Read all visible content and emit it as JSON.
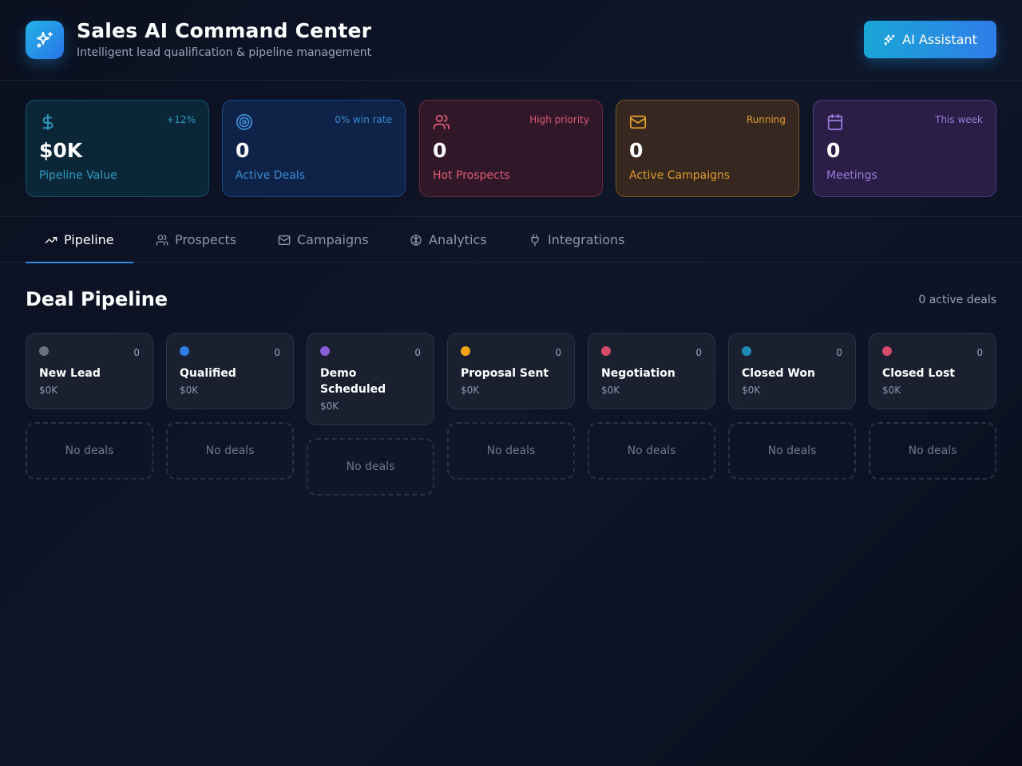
{
  "header": {
    "title": "Sales AI Command Center",
    "subtitle": "Intelligent lead qualification & pipeline management",
    "ai_button_label": "AI Assistant",
    "logo_icon": "sparkles-icon"
  },
  "stats": [
    {
      "icon": "dollar-icon",
      "tag": "+12%",
      "value": "$0K",
      "label": "Pipeline Value",
      "color": "#2d9cc4"
    },
    {
      "icon": "target-icon",
      "tag": "0% win rate",
      "value": "0",
      "label": "Active Deals",
      "color": "#3b8ad6"
    },
    {
      "icon": "users-icon",
      "tag": "High priority",
      "value": "0",
      "label": "Hot Prospects",
      "color": "#e05a78"
    },
    {
      "icon": "mail-icon",
      "tag": "Running",
      "value": "0",
      "label": "Active Campaigns",
      "color": "#e09a2a"
    },
    {
      "icon": "calendar-icon",
      "tag": "This week",
      "value": "0",
      "label": "Meetings",
      "color": "#9a7ad8"
    }
  ],
  "tabs": [
    {
      "label": "Pipeline",
      "icon": "trending-up-icon",
      "active": true
    },
    {
      "label": "Prospects",
      "icon": "users-icon",
      "active": false
    },
    {
      "label": "Campaigns",
      "icon": "mail-icon",
      "active": false
    },
    {
      "label": "Analytics",
      "icon": "brain-icon",
      "active": false
    },
    {
      "label": "Integrations",
      "icon": "plug-icon",
      "active": false
    }
  ],
  "pipeline": {
    "title": "Deal Pipeline",
    "count_text": "0 active deals",
    "empty_text": "No deals",
    "stages": [
      {
        "name": "New Lead",
        "count": "0",
        "amount": "$0K",
        "color": "#6b7280"
      },
      {
        "name": "Qualified",
        "count": "0",
        "amount": "$0K",
        "color": "#2f7de9"
      },
      {
        "name": "Demo Scheduled",
        "count": "0",
        "amount": "$0K",
        "color": "#8a5cd8"
      },
      {
        "name": "Proposal Sent",
        "count": "0",
        "amount": "$0K",
        "color": "#f0a616"
      },
      {
        "name": "Negotiation",
        "count": "0",
        "amount": "$0K",
        "color": "#d64a6a"
      },
      {
        "name": "Closed Won",
        "count": "0",
        "amount": "$0K",
        "color": "#1f8ab8"
      },
      {
        "name": "Closed Lost",
        "count": "0",
        "amount": "$0K",
        "color": "#d64a6a"
      }
    ]
  }
}
